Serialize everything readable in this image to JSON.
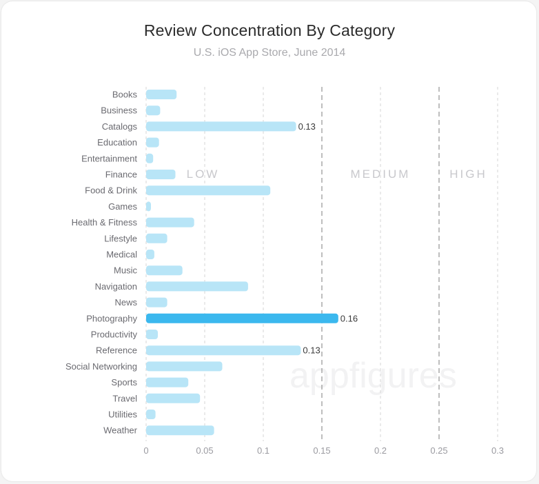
{
  "chart_data": {
    "type": "bar",
    "orientation": "horizontal",
    "title": "Review Concentration By Category",
    "subtitle": "U.S. iOS App Store, June 2014",
    "categories": [
      "Books",
      "Business",
      "Catalogs",
      "Education",
      "Entertainment",
      "Finance",
      "Food & Drink",
      "Games",
      "Health & Fitness",
      "Lifestyle",
      "Medical",
      "Music",
      "Navigation",
      "News",
      "Photography",
      "Productivity",
      "Reference",
      "Social Networking",
      "Sports",
      "Travel",
      "Utilities",
      "Weather"
    ],
    "values": [
      0.026,
      0.012,
      0.128,
      0.011,
      0.006,
      0.025,
      0.106,
      0.004,
      0.041,
      0.018,
      0.007,
      0.031,
      0.087,
      0.018,
      0.164,
      0.01,
      0.132,
      0.065,
      0.036,
      0.046,
      0.008,
      0.058
    ],
    "data_labels": {
      "Catalogs": "0.13",
      "Photography": "0.16",
      "Reference": "0.13"
    },
    "highlight": "Photography",
    "xlim": [
      0,
      0.3
    ],
    "xticks": [
      0,
      0.05,
      0.1,
      0.15,
      0.2,
      0.25,
      0.3
    ],
    "xtick_labels": [
      "0",
      "0.05",
      "0.1",
      "0.15",
      "0.2",
      "0.25",
      "0.3"
    ],
    "zones": [
      {
        "label": "LOW",
        "from": 0,
        "to": 0.15
      },
      {
        "label": "MEDIUM",
        "from": 0.15,
        "to": 0.25
      },
      {
        "label": "HIGH",
        "from": 0.25,
        "to": 0.3
      }
    ],
    "grid": true,
    "colors": {
      "bar": "#b8e5f7",
      "highlight": "#3bb8ee"
    },
    "watermark": "appfigures"
  }
}
